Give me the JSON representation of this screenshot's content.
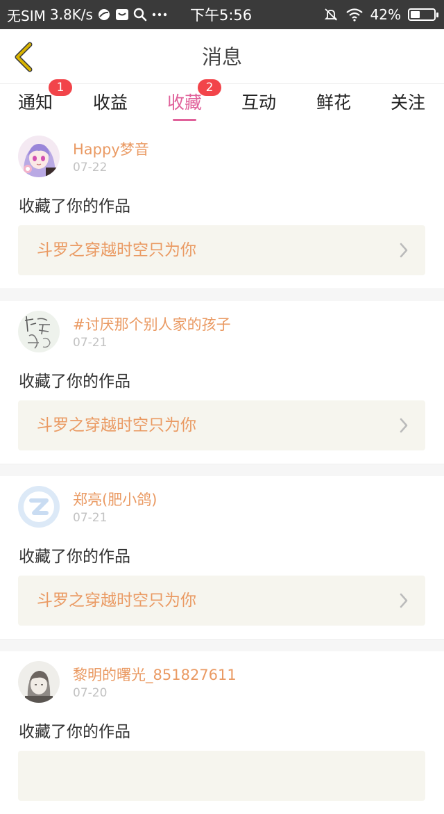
{
  "status_bar": {
    "carrier": "无SIM",
    "speed": "3.8K/s",
    "time": "下午5:56",
    "battery": "42%",
    "battery_level": 0.42
  },
  "header": {
    "title": "消息"
  },
  "tabs": [
    {
      "label": "通知",
      "badge": "1",
      "active": false
    },
    {
      "label": "收益",
      "badge": null,
      "active": false
    },
    {
      "label": "收藏",
      "badge": "2",
      "active": true
    },
    {
      "label": "互动",
      "badge": null,
      "active": false
    },
    {
      "label": "鲜花",
      "badge": null,
      "active": false
    },
    {
      "label": "关注",
      "badge": null,
      "active": false
    }
  ],
  "messages": [
    {
      "username": "Happy梦音",
      "date": "07-22",
      "action": "收藏了你的作品",
      "work": "斗罗之穿越时空只为你",
      "avatar": "anime-girl-avatar"
    },
    {
      "username": "#讨厌那个别人家的孩子",
      "date": "07-21",
      "action": "收藏了你的作品",
      "work": "斗罗之穿越时空只为你",
      "avatar": "calligraphy-avatar"
    },
    {
      "username": "郑亮(肥小鸽)",
      "date": "07-21",
      "action": "收藏了你的作品",
      "work": "斗罗之穿越时空只为你",
      "avatar": "default-avatar"
    },
    {
      "username": "黎明的曙光_851827611",
      "date": "07-20",
      "action": "收藏了你的作品",
      "work": "",
      "avatar": "sketch-avatar"
    }
  ],
  "colors": {
    "accent_pink": "#e0619a",
    "accent_orange": "#ea9a63",
    "badge_red": "#f2444a",
    "back_arrow_yellow": "#d9b400",
    "work_bg": "#f6f5ee"
  }
}
